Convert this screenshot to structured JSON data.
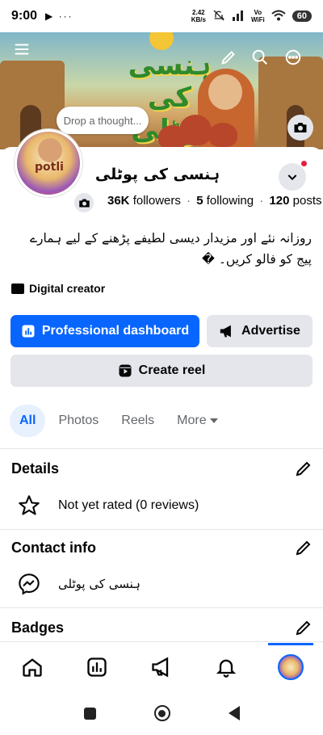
{
  "status_bar": {
    "time": "9:00",
    "left_icons": "▶ ···",
    "speed_value": "2.42",
    "speed_unit": "KB/s",
    "network_line1": "Vo",
    "network_line2": "WiFi",
    "battery": "60"
  },
  "cover": {
    "banner_text": "ہنسی کی پوٹلی",
    "icons": [
      "menu-icon",
      "edit-icon",
      "search-icon",
      "more-icon",
      "camera-icon"
    ],
    "thought_placeholder": "Drop a thought..."
  },
  "profile": {
    "avatar_text": "potli",
    "name": "ہنسی کی پوٹلی",
    "followers_count": "36K",
    "followers_label": "followers",
    "following_count": "5",
    "following_label": "following",
    "posts_count": "120",
    "posts_label": "posts",
    "bio": "روزانہ نئے اور مزیدار دیسی لطیفے پڑھنے کے لیے ہمارے پیج کو فالو کریں۔ �",
    "category": "Digital creator"
  },
  "buttons": {
    "dashboard": "Professional dashboard",
    "advertise": "Advertise",
    "create_reel": "Create reel"
  },
  "tabs": [
    {
      "label": "All",
      "active": true
    },
    {
      "label": "Photos",
      "active": false
    },
    {
      "label": "Reels",
      "active": false
    },
    {
      "label": "More",
      "active": false
    }
  ],
  "details": {
    "title": "Details",
    "rating": "Not yet rated (0 reviews)"
  },
  "contact": {
    "title": "Contact info",
    "messenger": "ہنسی کی پوٹلی"
  },
  "badges": {
    "title": "Badges"
  },
  "colors": {
    "accent": "#0866ff",
    "button_grey": "#e4e6eb",
    "notification_red": "#e41e3f"
  }
}
